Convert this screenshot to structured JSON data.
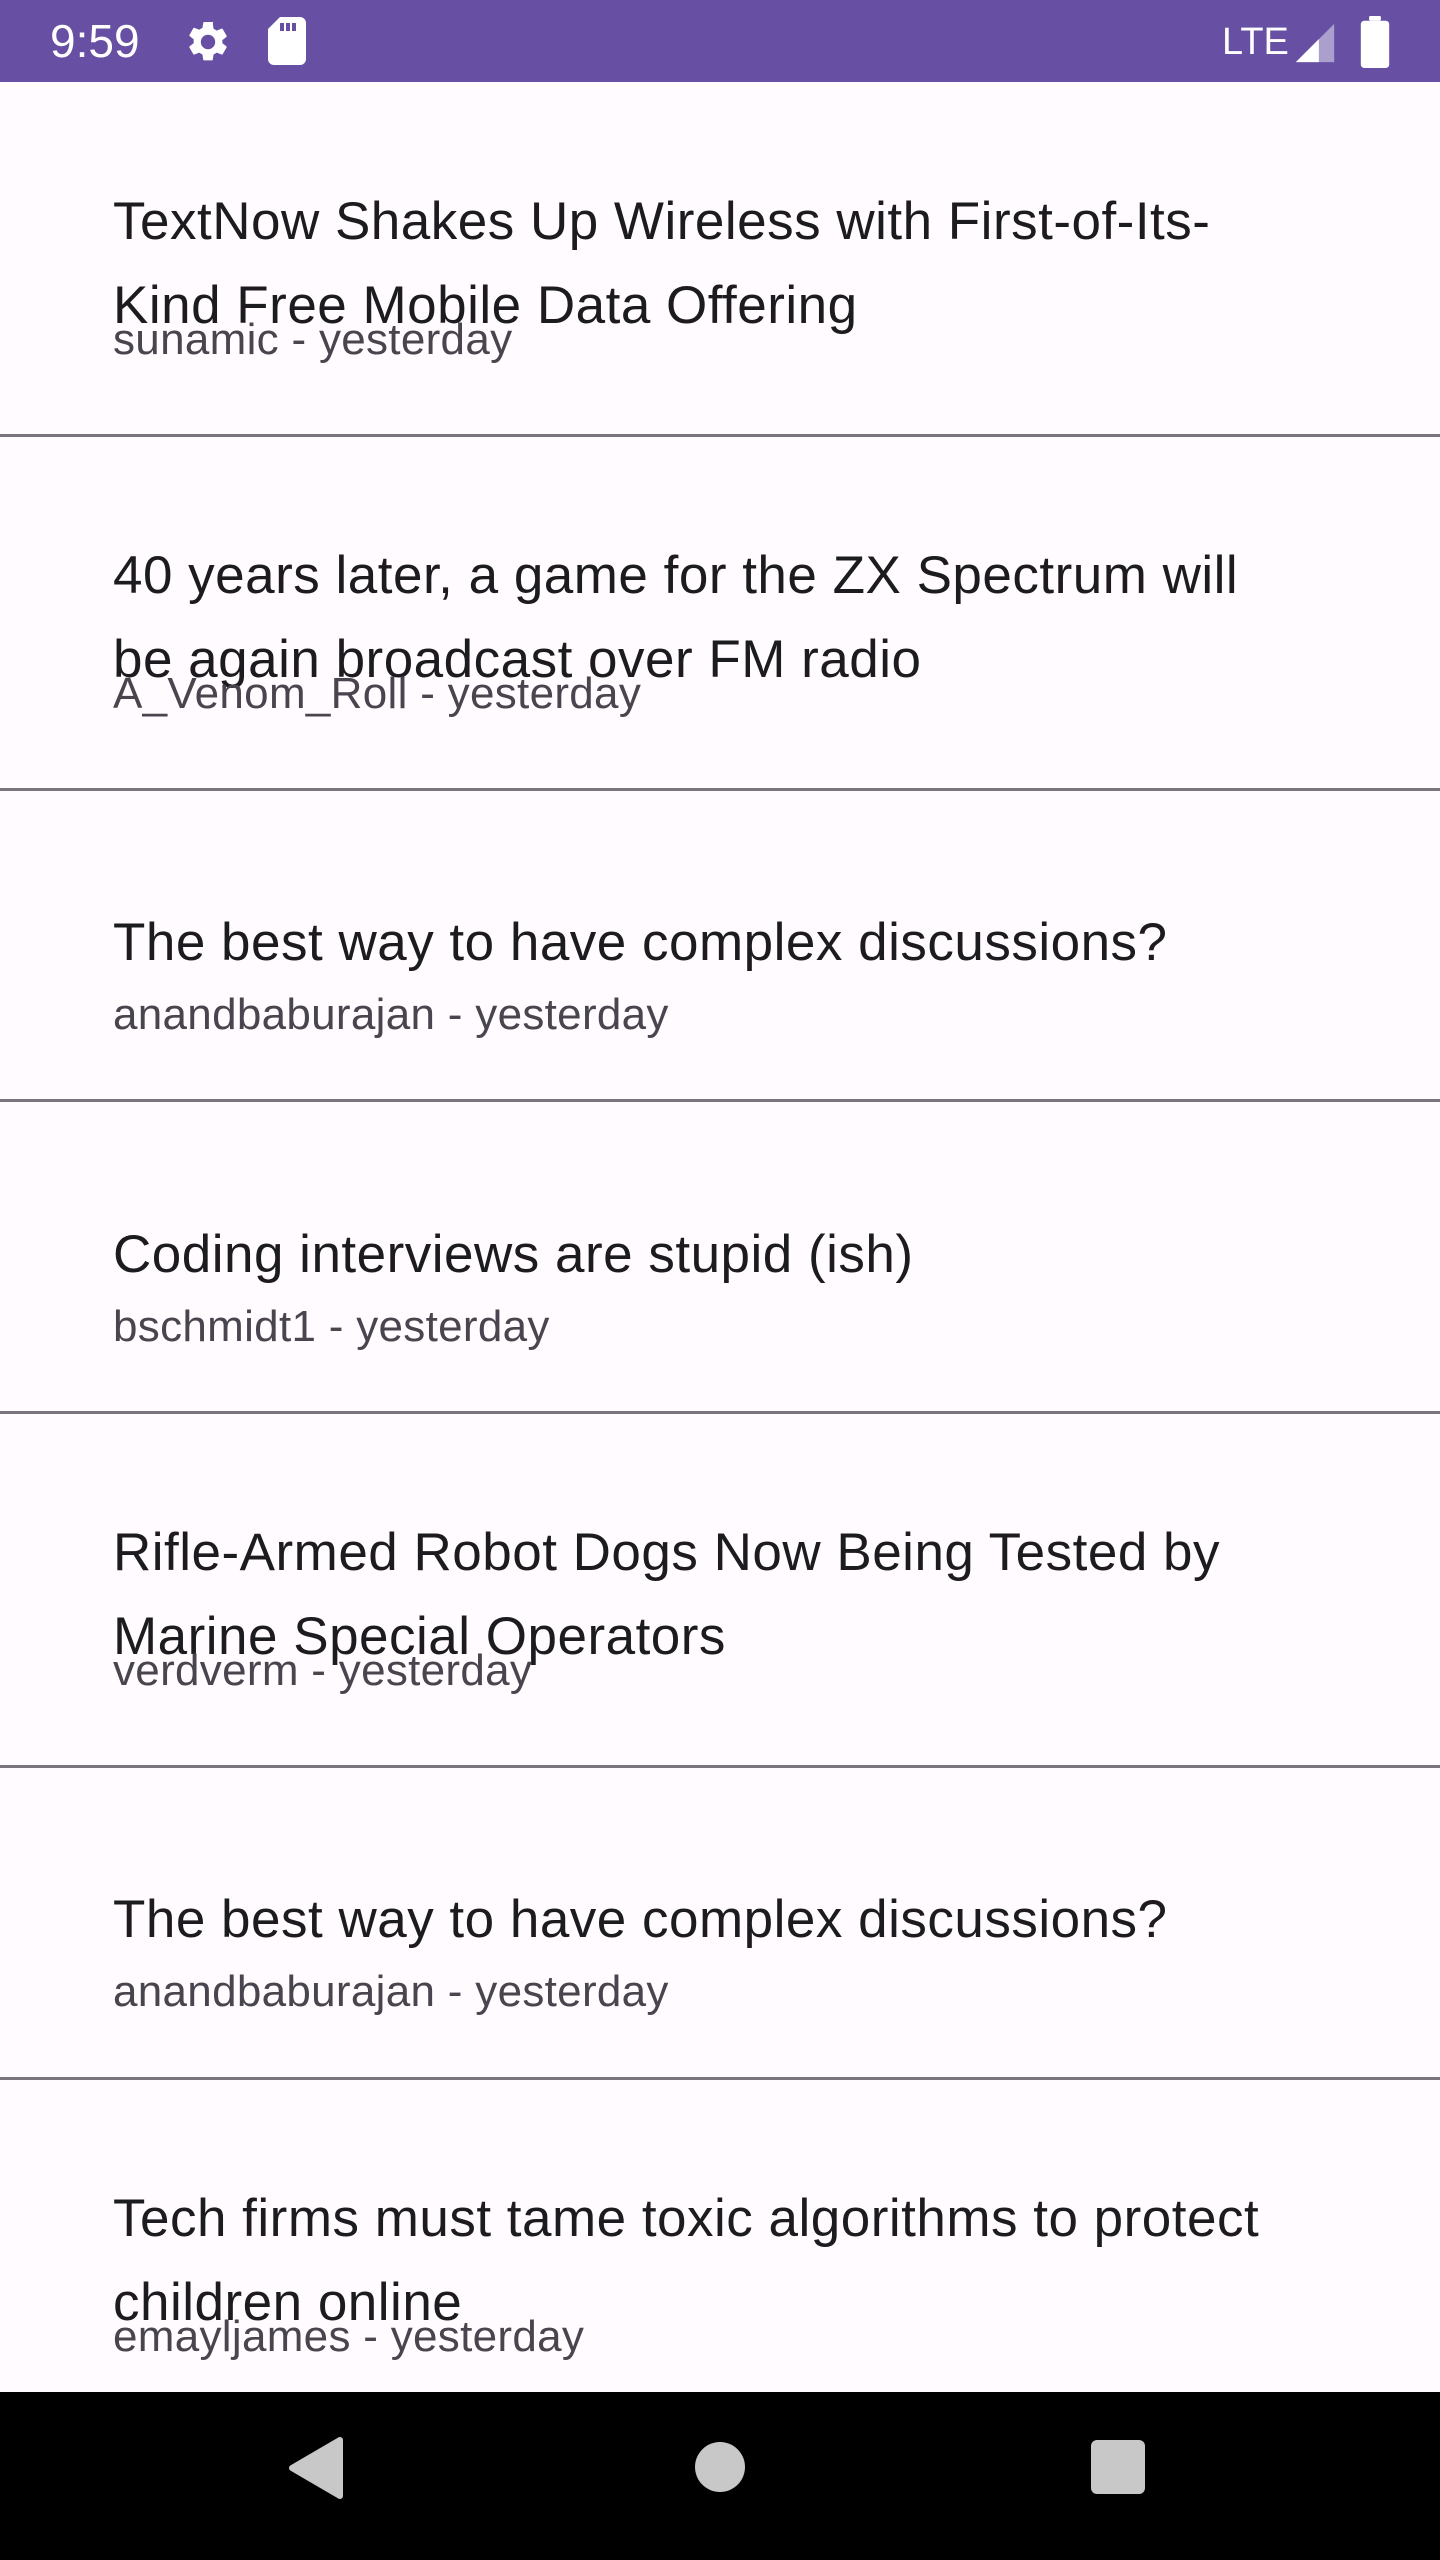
{
  "status_bar": {
    "time": "9:59",
    "network": "LTE",
    "background_color": "#6750a4",
    "icons": [
      "gear-icon",
      "sd-card-icon",
      "signal-icon",
      "battery-icon"
    ]
  },
  "stories": [
    {
      "title": "TextNow Shakes Up Wireless with First-of-Its-Kind Free Mobile Data Offering",
      "meta": "sunamic - yesterday"
    },
    {
      "title": "40 years later, a game for the ZX Spectrum will be again broadcast over FM radio",
      "meta": "A_Venom_Roll - yesterday"
    },
    {
      "title": "The best way to have complex discussions?",
      "meta": "anandbaburajan - yesterday"
    },
    {
      "title": "Coding interviews are stupid (ish)",
      "meta": "bschmidt1 - yesterday"
    },
    {
      "title": "Rifle-Armed Robot Dogs Now Being Tested by Marine Special Operators",
      "meta": "verdverm - yesterday"
    },
    {
      "title": "The best way to have complex discussions?",
      "meta": "anandbaburajan - yesterday"
    },
    {
      "title": "Tech firms must tame toxic algorithms to protect children online",
      "meta": "emayljames - yesterday"
    }
  ],
  "nav_bar": {
    "icons": [
      "back-icon",
      "home-icon",
      "recents-icon"
    ]
  }
}
